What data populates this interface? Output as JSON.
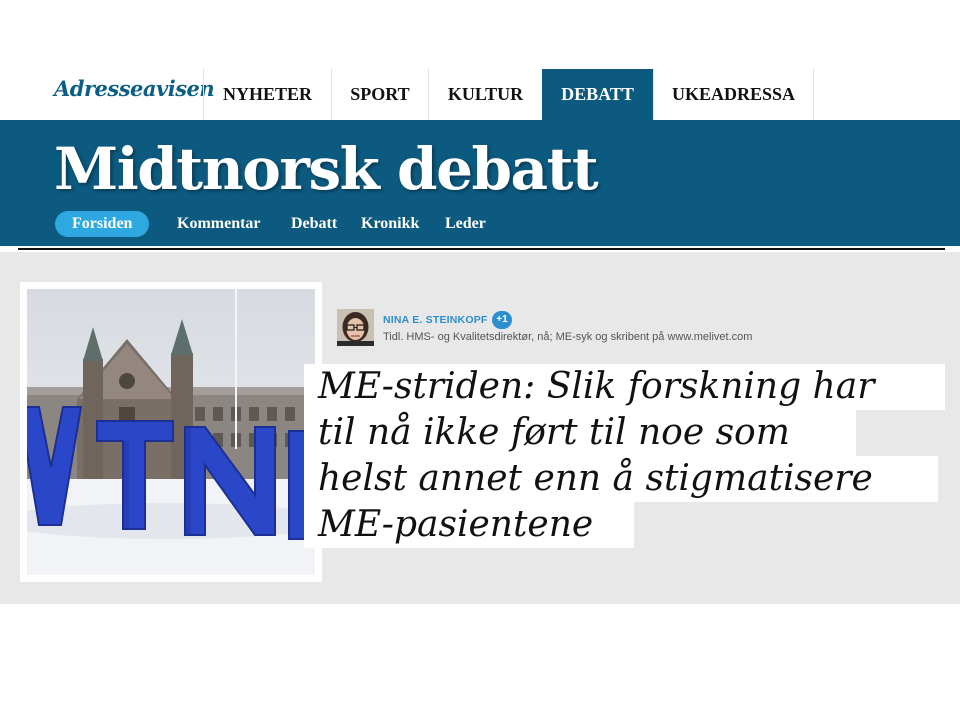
{
  "site": {
    "logo": "Adresseavisen",
    "nav": [
      "NYHETER",
      "SPORT",
      "KULTUR",
      "DEBATT",
      "UKEADRESSA"
    ],
    "active_nav": "DEBATT"
  },
  "section": {
    "title": "Midtnorsk debatt",
    "subnav": [
      "Forsiden",
      "Kommentar",
      "Debatt",
      "Kronikk",
      "Leder"
    ],
    "active_subnav": "Forsiden"
  },
  "article": {
    "author": "NINA E. STEINKOPF",
    "author_extra": "+1",
    "byline": "Tidl. HMS- og Kvalitetsdirektør, nå; ME-syk og skribent på www.melivet.com",
    "headline_lines": [
      "ME-striden: Slik forskning har",
      "til nå ikke ført til noe som",
      "helst annet enn å stigmatisere",
      "ME-pasientene"
    ],
    "image_sign": "NTNU"
  },
  "colors": {
    "brand": "#0c5a80",
    "accent": "#2ea8e0",
    "author_link": "#2e8fd0"
  }
}
